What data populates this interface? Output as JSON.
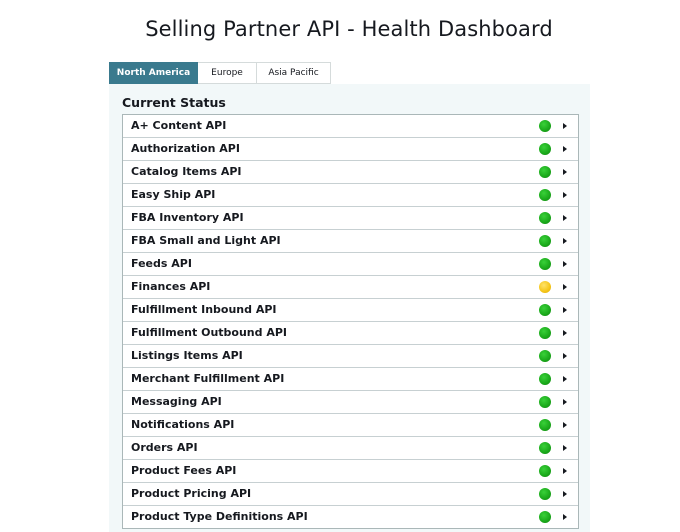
{
  "page_title": "Selling Partner API - Health Dashboard",
  "tabs": [
    {
      "label": "North America",
      "active": true
    },
    {
      "label": "Europe",
      "active": false
    },
    {
      "label": "Asia Pacific",
      "active": false
    }
  ],
  "panel": {
    "heading": "Current Status",
    "apis": [
      {
        "name": "A+ Content API",
        "status": "green"
      },
      {
        "name": "Authorization API",
        "status": "green"
      },
      {
        "name": "Catalog Items API",
        "status": "green"
      },
      {
        "name": "Easy Ship API",
        "status": "green"
      },
      {
        "name": "FBA Inventory API",
        "status": "green"
      },
      {
        "name": "FBA Small and Light API",
        "status": "green"
      },
      {
        "name": "Feeds API",
        "status": "green"
      },
      {
        "name": "Finances API",
        "status": "yellow"
      },
      {
        "name": "Fulfillment Inbound API",
        "status": "green"
      },
      {
        "name": "Fulfillment Outbound API",
        "status": "green"
      },
      {
        "name": "Listings Items API",
        "status": "green"
      },
      {
        "name": "Merchant Fulfillment API",
        "status": "green"
      },
      {
        "name": "Messaging API",
        "status": "green"
      },
      {
        "name": "Notifications API",
        "status": "green"
      },
      {
        "name": "Orders API",
        "status": "green"
      },
      {
        "name": "Product Fees API",
        "status": "green"
      },
      {
        "name": "Product Pricing API",
        "status": "green"
      },
      {
        "name": "Product Type Definitions API",
        "status": "green"
      }
    ]
  },
  "icons": {
    "status_indicator": "status-dot-icon",
    "row_expand": "caret-right-icon"
  },
  "colors": {
    "active_tab": "#3a7a8e",
    "panel_background": "#f2f8f9",
    "status_green": "#1aa81a",
    "status_yellow": "#f5c518"
  }
}
